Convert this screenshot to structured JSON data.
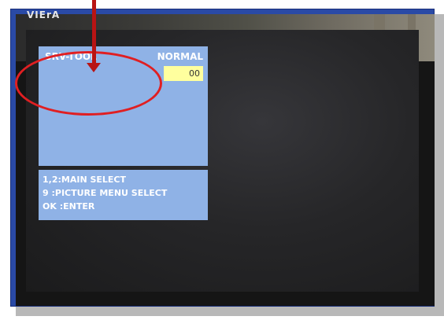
{
  "tv": {
    "brand": "VIErA"
  },
  "osd": {
    "title": "SRV-TOOL",
    "mode": "NORMAL",
    "value": "00"
  },
  "help": {
    "lines": [
      "1,2:MAIN SELECT",
      "9  :PICTURE MENU SELECT",
      "OK :ENTER"
    ]
  },
  "colors": {
    "frame": "#2a4aa6",
    "osd_panel": "#8fb2e6",
    "value_box": "#ffff9e",
    "highlight": "#e01f22"
  }
}
